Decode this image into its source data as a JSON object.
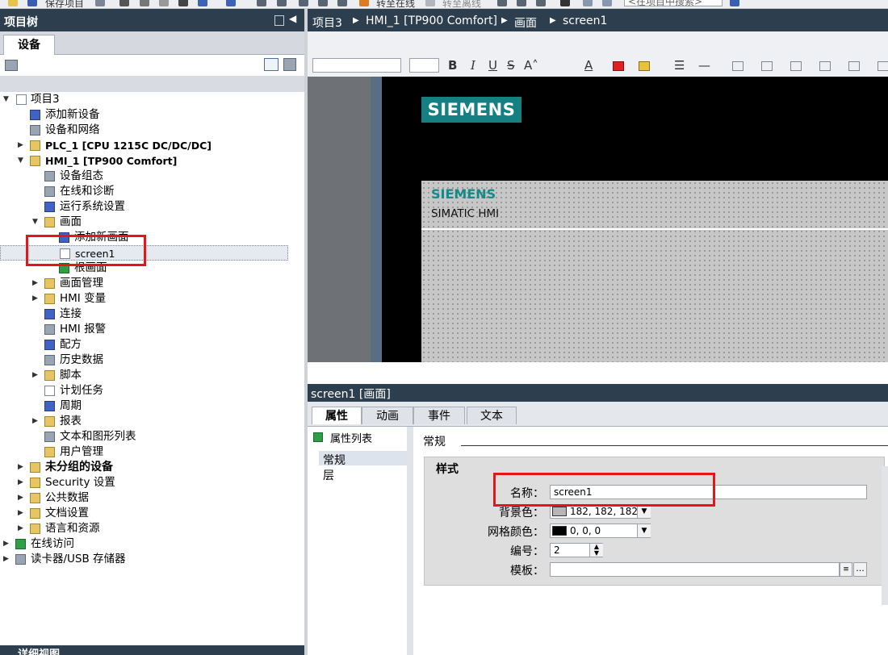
{
  "toolbar": {
    "save_project": "保存项目",
    "go_online": "转至在线",
    "go_offline": "转至离线",
    "search_placeholder": "<在项目中搜索>"
  },
  "project_tree": {
    "title": "项目树",
    "tab_devices": "设备",
    "nodes": [
      {
        "label": "项目3"
      },
      {
        "label": "添加新设备"
      },
      {
        "label": "设备和网络"
      },
      {
        "label": "PLC_1 [CPU 1215C DC/DC/DC]"
      },
      {
        "label": "HMI_1 [TP900 Comfort]"
      },
      {
        "label": "设备组态"
      },
      {
        "label": "在线和诊断"
      },
      {
        "label": "运行系统设置"
      },
      {
        "label": "画面"
      },
      {
        "label": "添加新画面"
      },
      {
        "label": "screen1"
      },
      {
        "label": "根画面"
      },
      {
        "label": "画面管理"
      },
      {
        "label": "HMI 变量"
      },
      {
        "label": "连接"
      },
      {
        "label": "HMI 报警"
      },
      {
        "label": "配方"
      },
      {
        "label": "历史数据"
      },
      {
        "label": "脚本"
      },
      {
        "label": "计划任务"
      },
      {
        "label": "周期"
      },
      {
        "label": "报表"
      },
      {
        "label": "文本和图形列表"
      },
      {
        "label": "用户管理"
      },
      {
        "label": "未分组的设备"
      },
      {
        "label": "Security 设置"
      },
      {
        "label": "公共数据"
      },
      {
        "label": "文档设置"
      },
      {
        "label": "语言和资源"
      },
      {
        "label": "在线访问"
      },
      {
        "label": "读卡器/USB 存储器"
      }
    ],
    "details_view": "详细视图"
  },
  "editor": {
    "breadcrumb": [
      "项目3",
      "HMI_1 [TP900 Comfort]",
      "画面",
      "screen1"
    ],
    "canvas": {
      "logo_top": "SIEMENS",
      "logo_panel": "SIEMENS",
      "panel_subtitle": "SIMATIC HMI"
    }
  },
  "inspector": {
    "title": "screen1 [画面]",
    "tabs": [
      "属性",
      "动画",
      "事件",
      "文本"
    ],
    "nav_header": "属性列表",
    "nav_items": [
      "常规",
      "层"
    ],
    "section": "常规",
    "group": "样式",
    "fields": {
      "name_label": "名称：",
      "name_value": "screen1",
      "bg_label": "背景色：",
      "bg_value": "182, 182, 182",
      "bg_color": "#b6b6b6",
      "grid_label": "网格颜色：",
      "grid_value": "0, 0, 0",
      "grid_color": "#000000",
      "number_label": "编号：",
      "number_value": "2",
      "template_label": "模板：",
      "template_value": ""
    }
  },
  "colors": {
    "titlebar": "#2d3e4e",
    "siemens_teal": "#148081",
    "highlight_red": "#e3161b"
  }
}
